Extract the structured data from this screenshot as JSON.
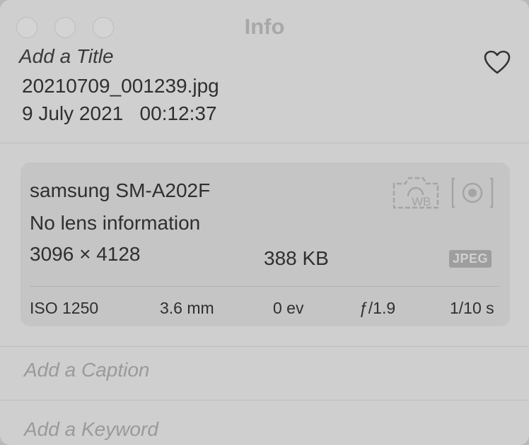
{
  "window": {
    "title": "Info"
  },
  "header": {
    "title_placeholder": "Add a Title",
    "filename": "20210709_001239.jpg",
    "date": "9 July 2021",
    "time": "00:12:37",
    "datetime_display": "9 July 2021   00:12:37",
    "favorite_icon": "heart-outline-icon"
  },
  "camera": {
    "model": "samsung SM-A202F",
    "lens": "No lens information",
    "dimensions": "3096 × 4128",
    "file_size": "388 KB",
    "format": "JPEG",
    "white_balance_icon": "camera-wb-icon",
    "metering_icon": "metering-icon"
  },
  "exif": {
    "iso": "ISO 1250",
    "focal_length": "3.6 mm",
    "exposure_bias": "0 ev",
    "aperture": "ƒ/1.9",
    "shutter_speed": "1/10 s"
  },
  "fields": {
    "caption_placeholder": "Add a Caption",
    "keyword_placeholder": "Add a Keyword"
  }
}
